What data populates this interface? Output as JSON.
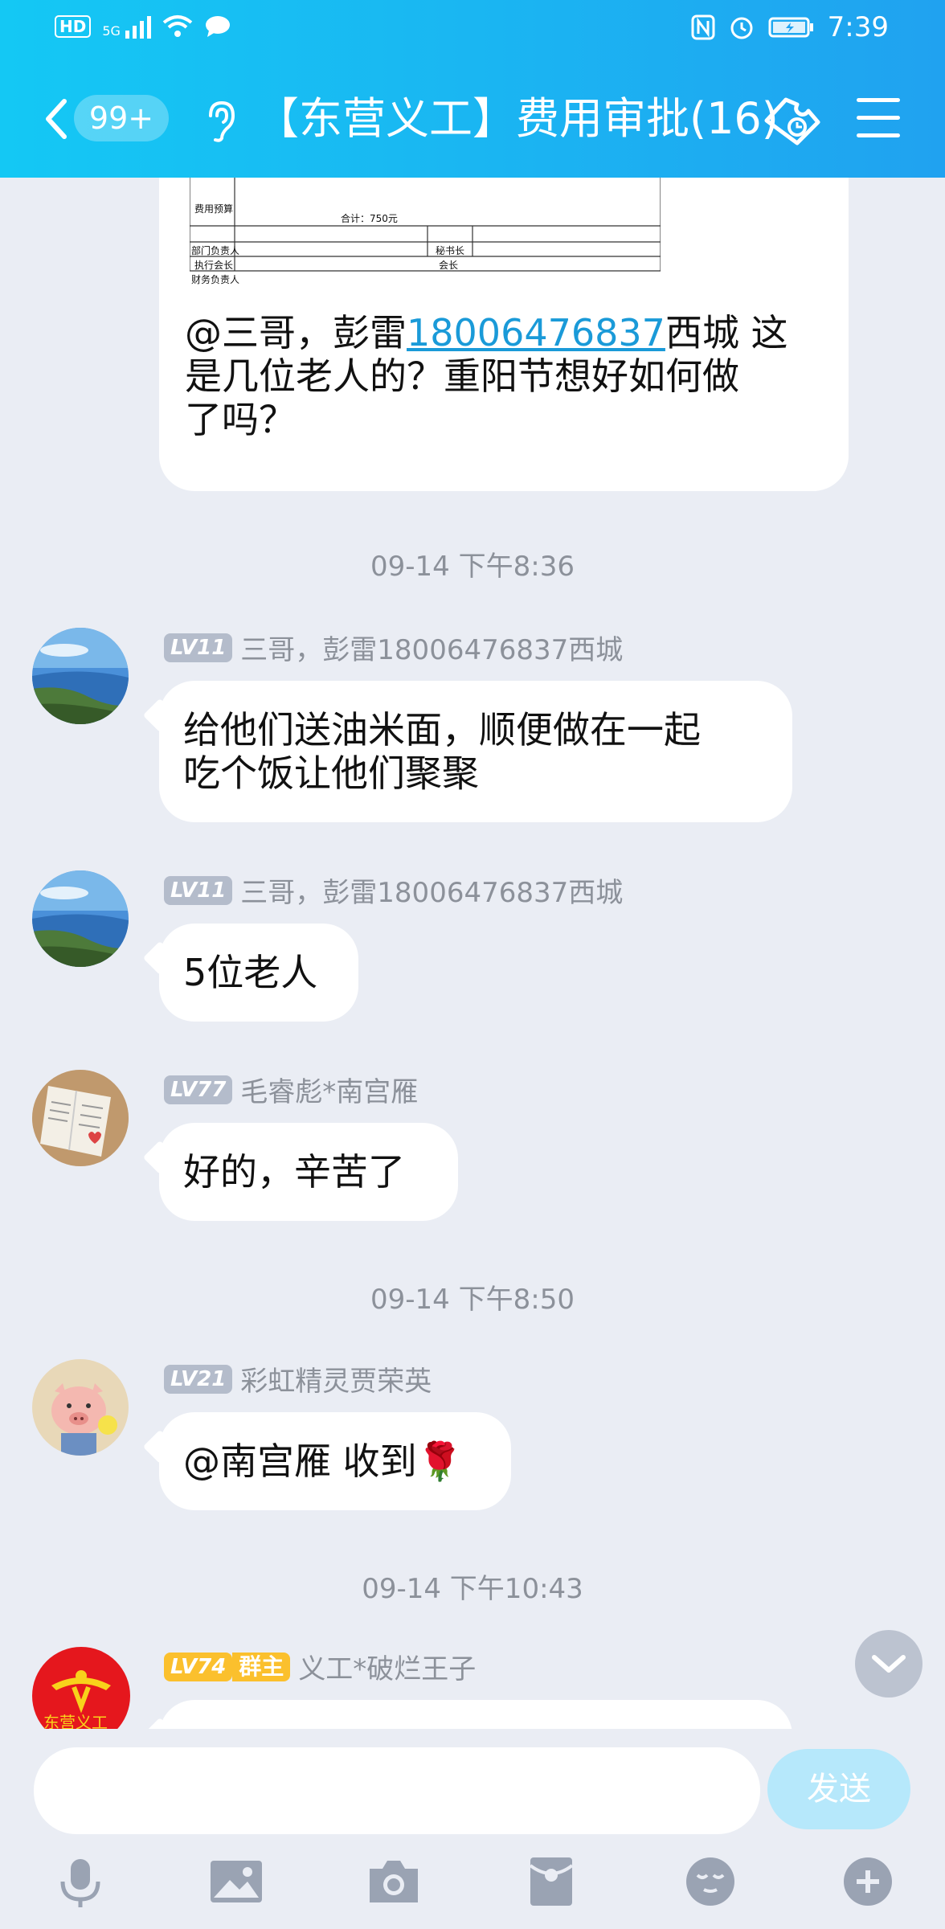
{
  "status_bar": {
    "hd": "HD",
    "network": "5G",
    "time": "7:39"
  },
  "header": {
    "unread_count": "99+",
    "title": "【东营义工】费用审批(16)"
  },
  "form_preview": {
    "row1_label": "费用预算",
    "total": "合计：750元",
    "row2_left": "部门负责人",
    "row2_right": "秘书长",
    "row3_left": "执行会长",
    "row3_right": "会长",
    "row4_left": "财务负责人"
  },
  "messages": {
    "m0": {
      "prefix": "@三哥，彭雷",
      "phone": "18006476837",
      "suffix_line1": "西城 这",
      "line2": "是几位老人的？重阳节想好如何做",
      "line3": "了吗？"
    },
    "t1": "09-14 下午8:36",
    "m1": {
      "level": "LV11",
      "sender": "三哥，彭雷18006476837西城",
      "line1": "给他们送油米面，顺便做在一起",
      "line2": "吃个饭让他们聚聚"
    },
    "m2": {
      "level": "LV11",
      "sender": "三哥，彭雷18006476837西城",
      "text": "5位老人"
    },
    "m3": {
      "level": "LV77",
      "sender": "毛睿彪*南宫雁",
      "text": "好的，辛苦了"
    },
    "t2": "09-14 下午8:50",
    "m4": {
      "level": "LV21",
      "sender": "彩虹精灵贾荣英",
      "text": "@南宫雁 收到",
      "emoji": "🌹"
    },
    "t3": "09-14 下午10:43",
    "m5": {
      "level": "LV74",
      "role": "群主",
      "sender": "义工*破烂王子",
      "avatar_text": "东营义工"
    }
  },
  "input": {
    "placeholder": "",
    "send_label": "发送"
  },
  "toolbar": [
    "mic-icon",
    "image-icon",
    "camera-icon",
    "red-packet-icon",
    "emoji-icon",
    "plus-icon"
  ]
}
